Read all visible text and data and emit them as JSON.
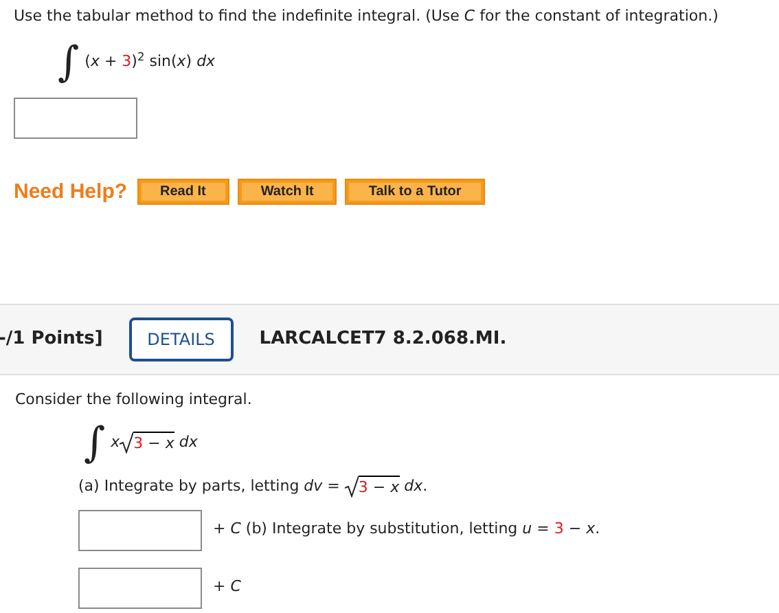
{
  "question_1": {
    "instruction": [
      {
        "kind": "text",
        "text": "Use the tabular method to find the indefinite integral. (Use *C* for the constant of integration.)"
      }
    ],
    "formula": [
      {
        "kind": "integral",
        "text": "∫"
      },
      {
        "kind": "text",
        "text": "(*x* + "
      },
      {
        "kind": "red",
        "text": "3"
      },
      {
        "kind": "text",
        "text": ")$^{2}$ sin(*x*) *dx*"
      }
    ],
    "help": {
      "label": "Need Help?",
      "buttons": [
        "Read It",
        "Watch It",
        "Talk to a Tutor"
      ]
    }
  },
  "question_2": {
    "points": "-/1 Points]",
    "details_button": "DETAILS",
    "code": "LARCALCET7 8.2.068.MI.",
    "prompt": [
      {
        "kind": "text",
        "text": "Consider the following integral."
      }
    ],
    "formula": [
      {
        "kind": "integral",
        "text": "∫"
      },
      {
        "kind": "text",
        "text": "*x*"
      },
      {
        "kind": "sqrt",
        "parts": [
          {
            "kind": "red",
            "text": "3"
          },
          {
            "kind": "text",
            "text": " − *x*"
          }
        ]
      },
      {
        "kind": "text",
        "text": " *dx*"
      }
    ],
    "part_a": [
      {
        "kind": "text",
        "text": "(a) Integrate by parts, letting *dv* = "
      },
      {
        "kind": "sqrt",
        "parts": [
          {
            "kind": "red",
            "text": "3"
          },
          {
            "kind": "text",
            "text": " − *x*"
          }
        ]
      },
      {
        "kind": "text",
        "text": " *dx*."
      }
    ],
    "answer_a_suffix": [
      {
        "kind": "text",
        "text": "+ *C* (b) Integrate by substitution, letting *u* = "
      },
      {
        "kind": "red",
        "text": "3"
      },
      {
        "kind": "text",
        "text": " − *x*."
      }
    ],
    "answer_b_suffix": [
      {
        "kind": "text",
        "text": "+ *C*"
      }
    ]
  }
}
